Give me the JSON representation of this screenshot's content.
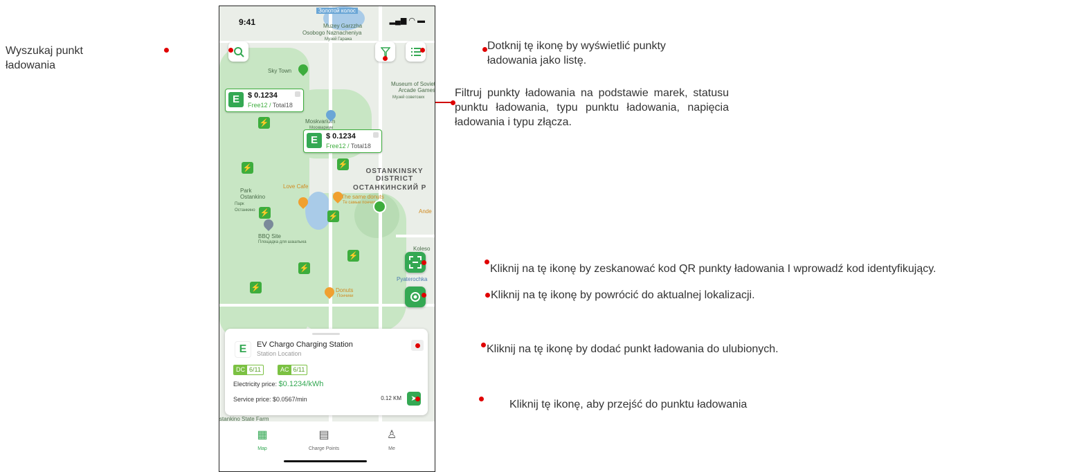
{
  "annotations": {
    "search": "Wyszukaj punkt ładowania",
    "list": "Dotknij tę ikonę by wyświetlić punkty ładowania jako listę.",
    "filter": "Filtruj punkty ładowania na podstawie marek, statusu punktu ładowania, typu punktu ładowania, napięcia ładowania i typu złącza.",
    "scan": "Kliknij na tę ikonę by zeskanować kod QR punkty ładowania I wprowadź kod identyfikujący.",
    "locate": "Kliknij na tę ikonę by powrócić do aktualnej lokalizacji.",
    "favorite": "Kliknij na tę ikonę by dodać punkt ładowania do ulubionych.",
    "navigate": "Kliknij tę ikonę, aby przejść do punktu ładowania"
  },
  "statusbar": {
    "time": "9:41",
    "icons": "▂▄▆ ◠ ▬"
  },
  "map_labels": {
    "top": "Золотой колос",
    "muzey": "Muzey Garzzha",
    "osobogo": "Osobogo Naznacheniya",
    "muzey_ru": "Музей Гаража",
    "sky_town": "Sky Town",
    "museum_soviet": "Museum of Soviet Arcade Games",
    "museum_soviet_ru": "Музей советских",
    "moskvarium": "Moskvarium",
    "moskvarium_ru": "Москвариум",
    "district_en": "OSTANKINSKY DISTRICT",
    "district_ru": "ОСТАНКИНСКИЙ Р",
    "park": "Park Ostankino",
    "park_ru": "Парк Останкино",
    "love_cafe": "Love Cafe",
    "same_donuts": "The same donuts",
    "same_donuts_ru": "Те самые пончики",
    "bbq": "BBQ Site",
    "bbq_ru": "Площадка для шашлыка",
    "pyaterochka": "Pyaterochka",
    "donuts": "Donuts",
    "donuts_ru": "Пончики",
    "koleso": "Koleso",
    "state_farm": "stankino State Farm",
    "ande": "Ande"
  },
  "bubbles": [
    {
      "price": "$ 0.1234",
      "free": "Free12",
      "total": "Total18"
    },
    {
      "price": "$ 0.1234",
      "free": "Free12",
      "total": "Total18"
    }
  ],
  "station": {
    "name": "EV Chargo Charging Station",
    "location": "Station Location",
    "dc_label": "DC",
    "dc_value": "6/11",
    "ac_label": "AC",
    "ac_value": "6/11",
    "electricity_label": "Electricity price:",
    "electricity_value": "$0.1234/kWh",
    "service_label": "Service price:",
    "service_value": "$0.0567/min",
    "distance": "0.12 KM"
  },
  "tabs": [
    {
      "label": "Map",
      "icon": "map-icon"
    },
    {
      "label": "Charge Points",
      "icon": "charger-icon"
    },
    {
      "label": "Me",
      "icon": "person-icon"
    }
  ],
  "colors": {
    "accent": "#34a853",
    "annotation": "#e00000"
  }
}
